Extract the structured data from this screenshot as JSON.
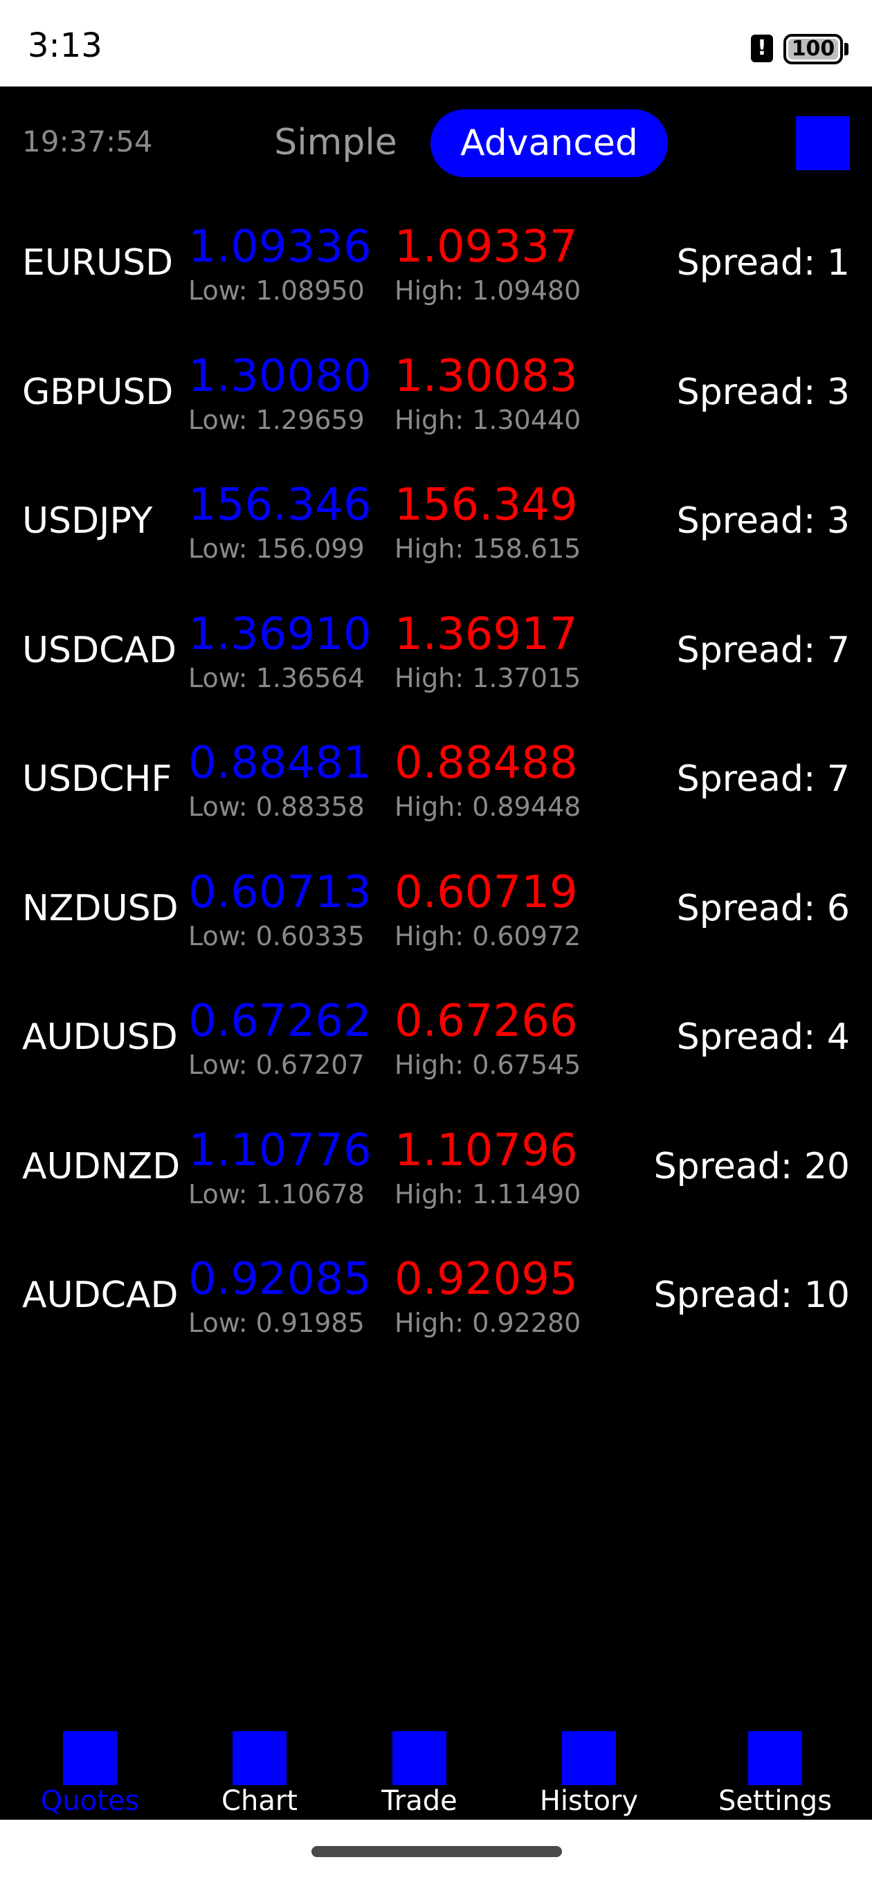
{
  "status_bar": {
    "time": "3:13",
    "alert_glyph": "!",
    "battery": "100"
  },
  "header": {
    "clock": "19:37:54",
    "tabs": [
      {
        "label": "Simple",
        "active": false
      },
      {
        "label": "Advanced",
        "active": true
      }
    ]
  },
  "quotes": [
    {
      "symbol": "EURUSD",
      "bid": "1.09336",
      "ask": "1.09337",
      "low": "Low: 1.08950",
      "high": "High: 1.09480",
      "spread": "Spread: 1"
    },
    {
      "symbol": "GBPUSD",
      "bid": "1.30080",
      "ask": "1.30083",
      "low": "Low: 1.29659",
      "high": "High: 1.30440",
      "spread": "Spread: 3"
    },
    {
      "symbol": "USDJPY",
      "bid": "156.346",
      "ask": "156.349",
      "low": "Low: 156.099",
      "high": "High: 158.615",
      "spread": "Spread: 3"
    },
    {
      "symbol": "USDCAD",
      "bid": "1.36910",
      "ask": "1.36917",
      "low": "Low: 1.36564",
      "high": "High: 1.37015",
      "spread": "Spread: 7"
    },
    {
      "symbol": "USDCHF",
      "bid": "0.88481",
      "ask": "0.88488",
      "low": "Low: 0.88358",
      "high": "High: 0.89448",
      "spread": "Spread: 7"
    },
    {
      "symbol": "NZDUSD",
      "bid": "0.60713",
      "ask": "0.60719",
      "low": "Low: 0.60335",
      "high": "High: 0.60972",
      "spread": "Spread: 6"
    },
    {
      "symbol": "AUDUSD",
      "bid": "0.67262",
      "ask": "0.67266",
      "low": "Low: 0.67207",
      "high": "High: 0.67545",
      "spread": "Spread: 4"
    },
    {
      "symbol": "AUDNZD",
      "bid": "1.10776",
      "ask": "1.10796",
      "low": "Low: 1.10678",
      "high": "High: 1.11490",
      "spread": "Spread: 20"
    },
    {
      "symbol": "AUDCAD",
      "bid": "0.92085",
      "ask": "0.92095",
      "low": "Low: 0.91985",
      "high": "High: 0.92280",
      "spread": "Spread: 10"
    }
  ],
  "nav": [
    {
      "label": "Quotes",
      "active": true
    },
    {
      "label": "Chart",
      "active": false
    },
    {
      "label": "Trade",
      "active": false
    },
    {
      "label": "History",
      "active": false
    },
    {
      "label": "Settings",
      "active": false
    }
  ],
  "colors": {
    "bid": "#0000ff",
    "ask": "#ff0000",
    "accent": "#0000ff",
    "muted": "#8a8a8a",
    "background": "#000000"
  }
}
